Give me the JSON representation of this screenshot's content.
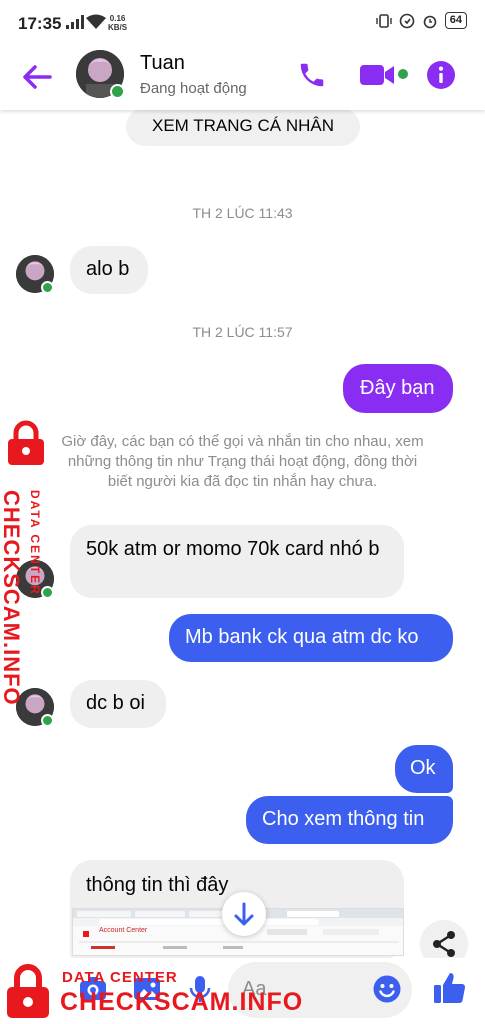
{
  "status_bar": {
    "time": "17:35",
    "net_speed_value": "0.16",
    "net_speed_unit": "KB/S",
    "battery": "64"
  },
  "header": {
    "contact_name": "Tuan",
    "contact_status": "Đang hoạt động",
    "accent_color": "#8a2df2"
  },
  "chat": {
    "profile_chip": "XEM TRANG CÁ NHÂN",
    "timestamp_1": "TH 2 LÚC 11:43",
    "msg_1": "alo b",
    "timestamp_2": "TH 2 LÚC 11:57",
    "msg_2": "Đây bạn",
    "system_note": "Giờ đây, các bạn có thể gọi và nhắn tin cho nhau, xem những thông tin như Trạng thái hoạt động, đồng thời biết người kia đã đọc tin nhắn hay chưa.",
    "msg_3": "50k atm or momo 70k card nhó b",
    "msg_4": "Mb bank ck qua atm dc ko",
    "msg_5": "dc b oi",
    "msg_6": "Ok",
    "msg_7": "Cho xem thông tin",
    "msg_8": "thông tin thì đây",
    "preview_title": "Account Center"
  },
  "composer": {
    "placeholder": "Aa"
  },
  "watermark": {
    "sub": "DATA CENTER",
    "main": "CHECKSCAM.INFO"
  },
  "icons": [
    "back-arrow-icon",
    "phone-icon",
    "video-camera-icon",
    "info-icon",
    "camera-icon",
    "image-icon",
    "microphone-icon",
    "emoji-icon",
    "thumbs-up-icon",
    "share-icon",
    "arrow-down-icon",
    "lock-icon"
  ]
}
